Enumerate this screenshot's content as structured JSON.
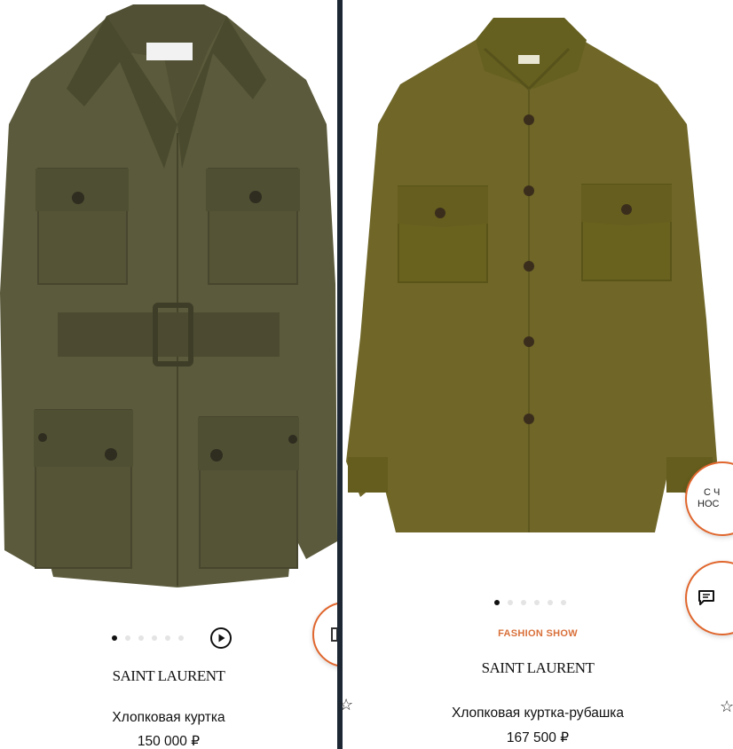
{
  "products": [
    {
      "brand": "SAINT LAURENT",
      "title": "Хлопковая куртка",
      "price": "150 000 ₽",
      "slides_total": 6,
      "slide_active": 1,
      "has_video": true
    },
    {
      "tag": "FASHION SHOW",
      "brand": "SAINT LAURENT",
      "title": "Хлопковая куртка-рубашка",
      "price": "167 500 ₽",
      "slides_total": 6,
      "slide_active": 1
    }
  ],
  "floating": {
    "badge_text_line1": "С Ч",
    "badge_text_line2": "НОС"
  },
  "colors": {
    "jacket_left": "#5b5a3c",
    "jacket_right": "#6f6628",
    "accent": "#e0662d",
    "backdrop": "#1c2733"
  },
  "icons": [
    "play-icon",
    "chat-icon",
    "wishlist-icon",
    "video-icon"
  ]
}
